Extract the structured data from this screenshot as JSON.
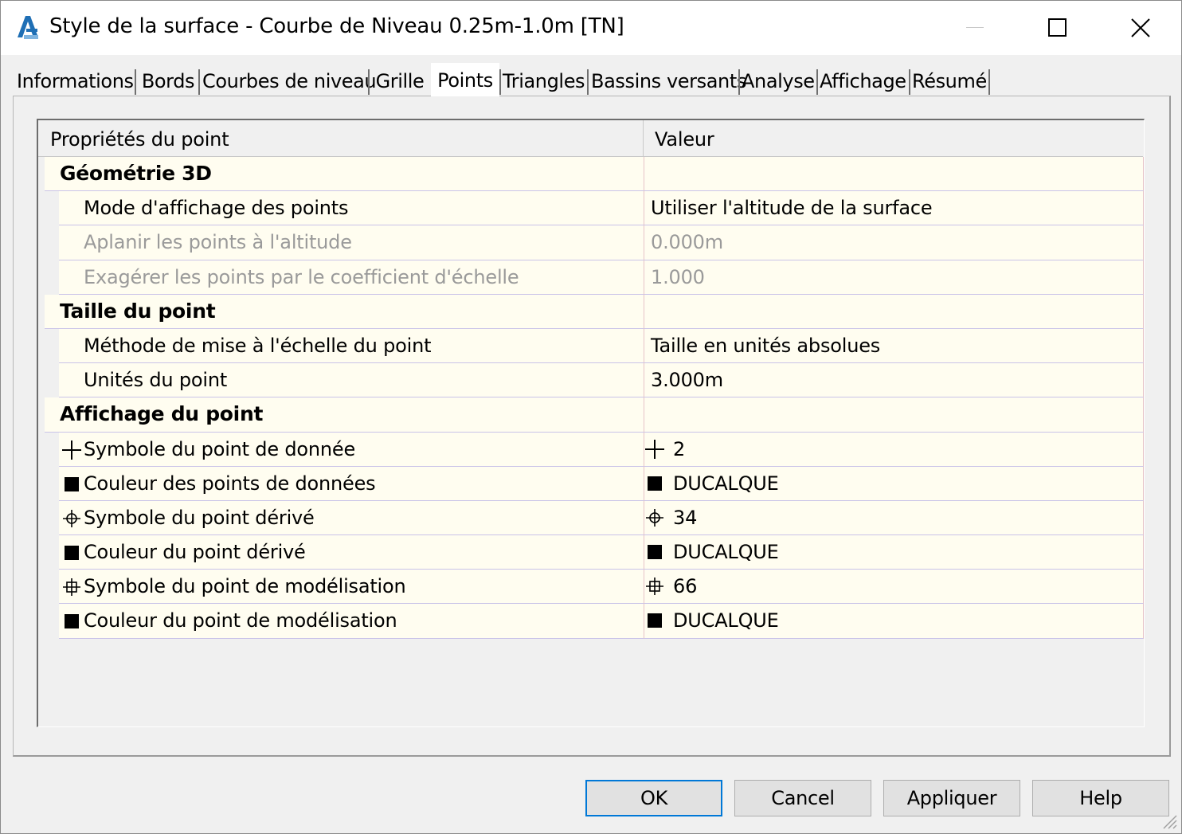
{
  "window": {
    "title": "Style de la surface - Courbe de Niveau 0.25m-1.0m [TN]"
  },
  "tabs": [
    {
      "label": "Informations",
      "active": false
    },
    {
      "label": "Bords",
      "active": false
    },
    {
      "label": "Courbes de niveau",
      "active": false
    },
    {
      "label": "Grille",
      "active": false
    },
    {
      "label": "Points",
      "active": true
    },
    {
      "label": "Triangles",
      "active": false
    },
    {
      "label": "Bassins versants",
      "active": false
    },
    {
      "label": "Analyse",
      "active": false
    },
    {
      "label": "Affichage",
      "active": false
    },
    {
      "label": "Résumé",
      "active": false
    }
  ],
  "grid": {
    "col_property": "Propriétés du point",
    "col_value": "Valeur",
    "groups": {
      "geometry": {
        "label": "Géométrie 3D",
        "rows": [
          {
            "label": "Mode d'affichage des points",
            "value": "Utiliser l'altitude de la surface",
            "disabled": false
          },
          {
            "label": "Aplanir les points à l'altitude",
            "value": "0.000m",
            "disabled": true
          },
          {
            "label": "Exagérer les points par le coefficient d'échelle",
            "value": "1.000",
            "disabled": true
          }
        ]
      },
      "size": {
        "label": "Taille du point",
        "rows": [
          {
            "label": "Méthode de mise à l'échelle du point",
            "value": "Taille en unités absolues"
          },
          {
            "label": "Unités du point",
            "value": "3.000m"
          }
        ]
      },
      "display": {
        "label": "Affichage du point",
        "rows": [
          {
            "label": "Symbole du point de donnée",
            "value": "2",
            "icon": "plus-symbol-icon"
          },
          {
            "label": "Couleur des points de données",
            "value": "DUCALQUE",
            "icon": "color-swatch-icon"
          },
          {
            "label": "Symbole du point dérivé",
            "value": "34",
            "icon": "circle-cross-symbol-icon"
          },
          {
            "label": "Couleur du point dérivé",
            "value": "DUCALQUE",
            "icon": "color-swatch-icon"
          },
          {
            "label": "Symbole du point de modélisation",
            "value": "66",
            "icon": "square-cross-symbol-icon"
          },
          {
            "label": "Couleur du point de modélisation",
            "value": "DUCALQUE",
            "icon": "color-swatch-icon"
          }
        ]
      }
    }
  },
  "buttons": {
    "ok": "OK",
    "cancel": "Cancel",
    "apply": "Appliquer",
    "help": "Help"
  },
  "colors": {
    "row_background": "#fffdf0",
    "accent": "#0078d7",
    "disabled_text": "#9a9a9a",
    "app_icon": "#1f6fb5"
  }
}
